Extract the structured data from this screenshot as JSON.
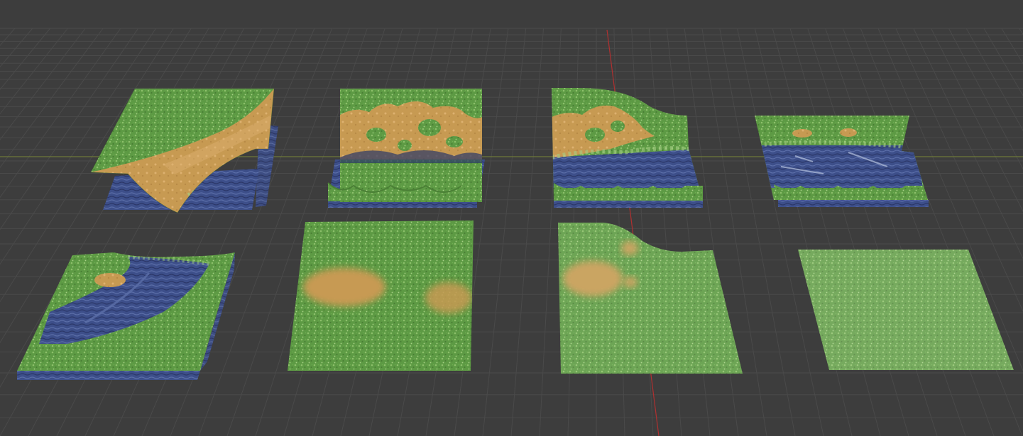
{
  "viewport": {
    "background": "#3d3d3d",
    "grid_color": "#4a4a4a",
    "x_axis_color": "#6e7a3a",
    "y_axis_color": "#b03030"
  },
  "materials": {
    "grass": "#5d9a44",
    "grass_light": "#8cc06a",
    "sand": "#c79a52",
    "sand_light": "#ddb170",
    "water": "#3d4f8a",
    "water_dark": "#2b3768",
    "water_light": "#7d8fbf"
  },
  "tiles": [
    {
      "id": "tile-1",
      "kind": "diagonal-beach-corner"
    },
    {
      "id": "tile-2",
      "kind": "straight-beach-edge"
    },
    {
      "id": "tile-3",
      "kind": "beach-edge-with-raised-corner"
    },
    {
      "id": "tile-4",
      "kind": "shallow-water-edge"
    },
    {
      "id": "tile-5",
      "kind": "water-inner-corner"
    },
    {
      "id": "tile-6",
      "kind": "grass-with-sand-patches"
    },
    {
      "id": "tile-7",
      "kind": "grass-raised-corner"
    },
    {
      "id": "tile-8",
      "kind": "plain-grass"
    }
  ]
}
